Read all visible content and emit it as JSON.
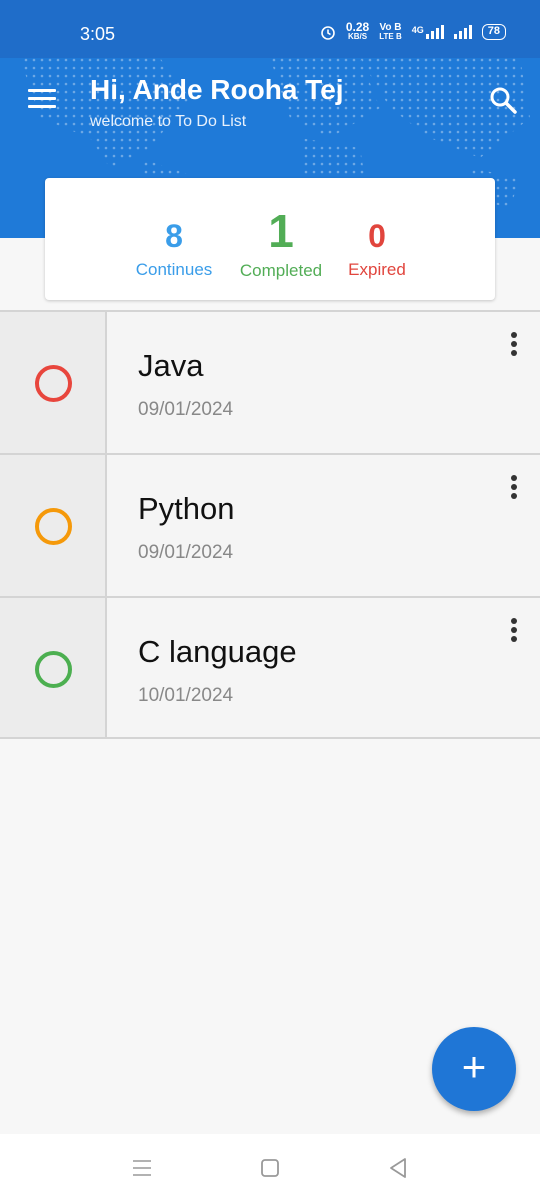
{
  "status_bar": {
    "time": "3:05",
    "net_speed_value": "0.28",
    "net_speed_unit": "KB/S",
    "volte_top": "Vo B",
    "volte_bottom": "LTE B",
    "network": "4G",
    "battery": "78"
  },
  "header": {
    "greeting": "Hi, Ande Rooha Tej",
    "subtitle": "welcome to To Do List",
    "background_color": "#1f7ad8"
  },
  "stats": {
    "continues": {
      "value": "8",
      "label": "Continues",
      "color": "#3a9de9"
    },
    "completed": {
      "value": "1",
      "label": "Completed",
      "color": "#52ad56"
    },
    "expired": {
      "value": "0",
      "label": "Expired",
      "color": "#e1453d"
    }
  },
  "tasks": [
    {
      "title": "Java",
      "date": "09/01/2024",
      "status_color": "#e8463d"
    },
    {
      "title": "Python",
      "date": "09/01/2024",
      "status_color": "#f5990a"
    },
    {
      "title": "C language",
      "date": "10/01/2024",
      "status_color": "#4caf50"
    }
  ],
  "fab": {
    "label": "+",
    "color": "#1f76d6"
  },
  "icons": {
    "menu": "menu-icon",
    "search": "search-icon",
    "more": "more-vertical-icon",
    "nav_recent": "recent-apps-icon",
    "nav_home": "home-icon",
    "nav_back": "back-icon"
  }
}
